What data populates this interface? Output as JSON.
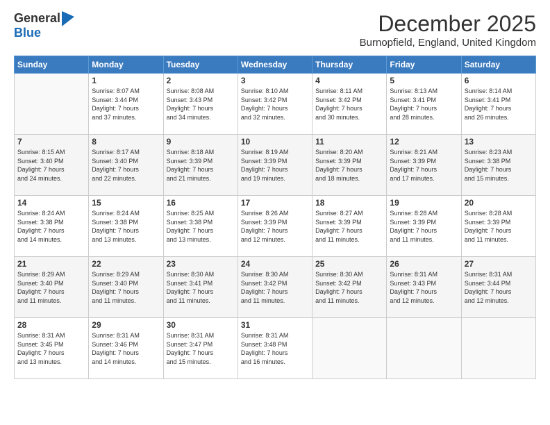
{
  "header": {
    "logo_line1": "General",
    "logo_line2": "Blue",
    "month": "December 2025",
    "location": "Burnopfield, England, United Kingdom"
  },
  "weekdays": [
    "Sunday",
    "Monday",
    "Tuesday",
    "Wednesday",
    "Thursday",
    "Friday",
    "Saturday"
  ],
  "weeks": [
    [
      {
        "day": "",
        "info": ""
      },
      {
        "day": "1",
        "info": "Sunrise: 8:07 AM\nSunset: 3:44 PM\nDaylight: 7 hours\nand 37 minutes."
      },
      {
        "day": "2",
        "info": "Sunrise: 8:08 AM\nSunset: 3:43 PM\nDaylight: 7 hours\nand 34 minutes."
      },
      {
        "day": "3",
        "info": "Sunrise: 8:10 AM\nSunset: 3:42 PM\nDaylight: 7 hours\nand 32 minutes."
      },
      {
        "day": "4",
        "info": "Sunrise: 8:11 AM\nSunset: 3:42 PM\nDaylight: 7 hours\nand 30 minutes."
      },
      {
        "day": "5",
        "info": "Sunrise: 8:13 AM\nSunset: 3:41 PM\nDaylight: 7 hours\nand 28 minutes."
      },
      {
        "day": "6",
        "info": "Sunrise: 8:14 AM\nSunset: 3:41 PM\nDaylight: 7 hours\nand 26 minutes."
      }
    ],
    [
      {
        "day": "7",
        "info": "Sunrise: 8:15 AM\nSunset: 3:40 PM\nDaylight: 7 hours\nand 24 minutes."
      },
      {
        "day": "8",
        "info": "Sunrise: 8:17 AM\nSunset: 3:40 PM\nDaylight: 7 hours\nand 22 minutes."
      },
      {
        "day": "9",
        "info": "Sunrise: 8:18 AM\nSunset: 3:39 PM\nDaylight: 7 hours\nand 21 minutes."
      },
      {
        "day": "10",
        "info": "Sunrise: 8:19 AM\nSunset: 3:39 PM\nDaylight: 7 hours\nand 19 minutes."
      },
      {
        "day": "11",
        "info": "Sunrise: 8:20 AM\nSunset: 3:39 PM\nDaylight: 7 hours\nand 18 minutes."
      },
      {
        "day": "12",
        "info": "Sunrise: 8:21 AM\nSunset: 3:39 PM\nDaylight: 7 hours\nand 17 minutes."
      },
      {
        "day": "13",
        "info": "Sunrise: 8:23 AM\nSunset: 3:38 PM\nDaylight: 7 hours\nand 15 minutes."
      }
    ],
    [
      {
        "day": "14",
        "info": "Sunrise: 8:24 AM\nSunset: 3:38 PM\nDaylight: 7 hours\nand 14 minutes."
      },
      {
        "day": "15",
        "info": "Sunrise: 8:24 AM\nSunset: 3:38 PM\nDaylight: 7 hours\nand 13 minutes."
      },
      {
        "day": "16",
        "info": "Sunrise: 8:25 AM\nSunset: 3:38 PM\nDaylight: 7 hours\nand 13 minutes."
      },
      {
        "day": "17",
        "info": "Sunrise: 8:26 AM\nSunset: 3:39 PM\nDaylight: 7 hours\nand 12 minutes."
      },
      {
        "day": "18",
        "info": "Sunrise: 8:27 AM\nSunset: 3:39 PM\nDaylight: 7 hours\nand 11 minutes."
      },
      {
        "day": "19",
        "info": "Sunrise: 8:28 AM\nSunset: 3:39 PM\nDaylight: 7 hours\nand 11 minutes."
      },
      {
        "day": "20",
        "info": "Sunrise: 8:28 AM\nSunset: 3:39 PM\nDaylight: 7 hours\nand 11 minutes."
      }
    ],
    [
      {
        "day": "21",
        "info": "Sunrise: 8:29 AM\nSunset: 3:40 PM\nDaylight: 7 hours\nand 11 minutes."
      },
      {
        "day": "22",
        "info": "Sunrise: 8:29 AM\nSunset: 3:40 PM\nDaylight: 7 hours\nand 11 minutes."
      },
      {
        "day": "23",
        "info": "Sunrise: 8:30 AM\nSunset: 3:41 PM\nDaylight: 7 hours\nand 11 minutes."
      },
      {
        "day": "24",
        "info": "Sunrise: 8:30 AM\nSunset: 3:42 PM\nDaylight: 7 hours\nand 11 minutes."
      },
      {
        "day": "25",
        "info": "Sunrise: 8:30 AM\nSunset: 3:42 PM\nDaylight: 7 hours\nand 11 minutes."
      },
      {
        "day": "26",
        "info": "Sunrise: 8:31 AM\nSunset: 3:43 PM\nDaylight: 7 hours\nand 12 minutes."
      },
      {
        "day": "27",
        "info": "Sunrise: 8:31 AM\nSunset: 3:44 PM\nDaylight: 7 hours\nand 12 minutes."
      }
    ],
    [
      {
        "day": "28",
        "info": "Sunrise: 8:31 AM\nSunset: 3:45 PM\nDaylight: 7 hours\nand 13 minutes."
      },
      {
        "day": "29",
        "info": "Sunrise: 8:31 AM\nSunset: 3:46 PM\nDaylight: 7 hours\nand 14 minutes."
      },
      {
        "day": "30",
        "info": "Sunrise: 8:31 AM\nSunset: 3:47 PM\nDaylight: 7 hours\nand 15 minutes."
      },
      {
        "day": "31",
        "info": "Sunrise: 8:31 AM\nSunset: 3:48 PM\nDaylight: 7 hours\nand 16 minutes."
      },
      {
        "day": "",
        "info": ""
      },
      {
        "day": "",
        "info": ""
      },
      {
        "day": "",
        "info": ""
      }
    ]
  ]
}
